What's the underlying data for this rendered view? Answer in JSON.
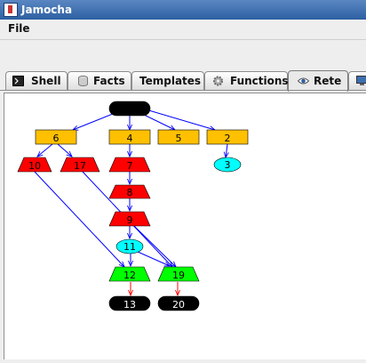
{
  "window": {
    "title": "Jamocha"
  },
  "menu": {
    "file": "File"
  },
  "tabs": [
    {
      "label": "Shell",
      "icon": "terminal-icon"
    },
    {
      "label": "Facts",
      "icon": "database-icon"
    },
    {
      "label": "Templates",
      "icon": "document-icon"
    },
    {
      "label": "Functions",
      "icon": "gear-icon"
    },
    {
      "label": "Rete",
      "icon": "eye-icon",
      "active": true
    }
  ],
  "rete": {
    "colors": {
      "rect": "#ffc000",
      "trap_red": "#ff0000",
      "ellipse": "#00ffff",
      "trap_green": "#00ff00",
      "terminal": "#000000",
      "edge": "#0000ff",
      "edge_terminal": "#ff0000"
    },
    "nodes": {
      "n6": "6",
      "n4": "4",
      "n5": "5",
      "n2": "2",
      "n3": "3",
      "n10": "10",
      "n17": "17",
      "n7": "7",
      "n8": "8",
      "n9": "9",
      "n11": "11",
      "n12": "12",
      "n19": "19",
      "n13": "13",
      "n20": "20"
    }
  }
}
